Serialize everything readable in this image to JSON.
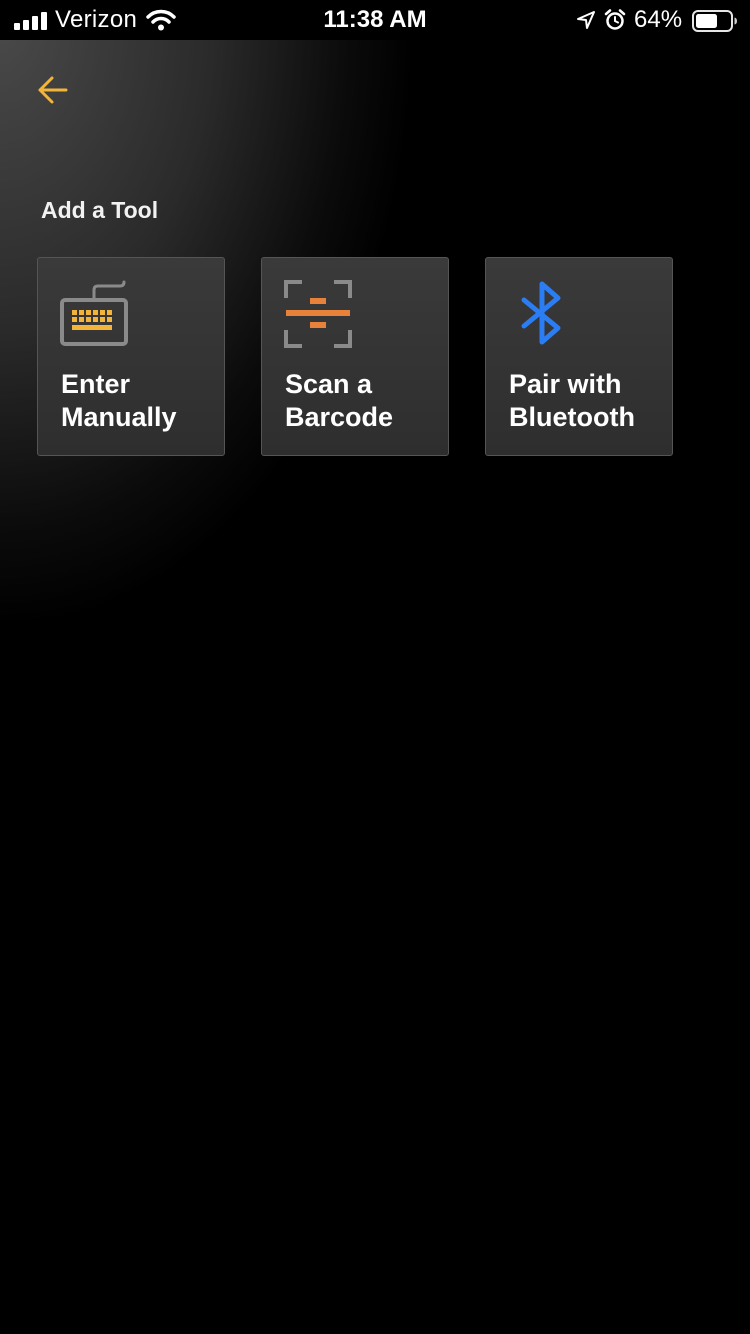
{
  "status_bar": {
    "carrier": "Verizon",
    "time": "11:38 AM",
    "battery": "64%",
    "battery_level": 0.64
  },
  "header": {
    "back_icon": "arrow-left-icon"
  },
  "section": {
    "title": "Add a Tool"
  },
  "options": [
    {
      "label": "Enter Manually",
      "icon": "keyboard-icon"
    },
    {
      "label": "Scan a Barcode",
      "icon": "barcode-scan-icon"
    },
    {
      "label": "Pair with Bluetooth",
      "icon": "bluetooth-icon"
    }
  ],
  "colors": {
    "accent_yellow": "#f2b53a",
    "scan_orange": "#e8823a",
    "bluetooth_blue": "#2a7df2",
    "icon_gray": "#8a8a8a"
  }
}
